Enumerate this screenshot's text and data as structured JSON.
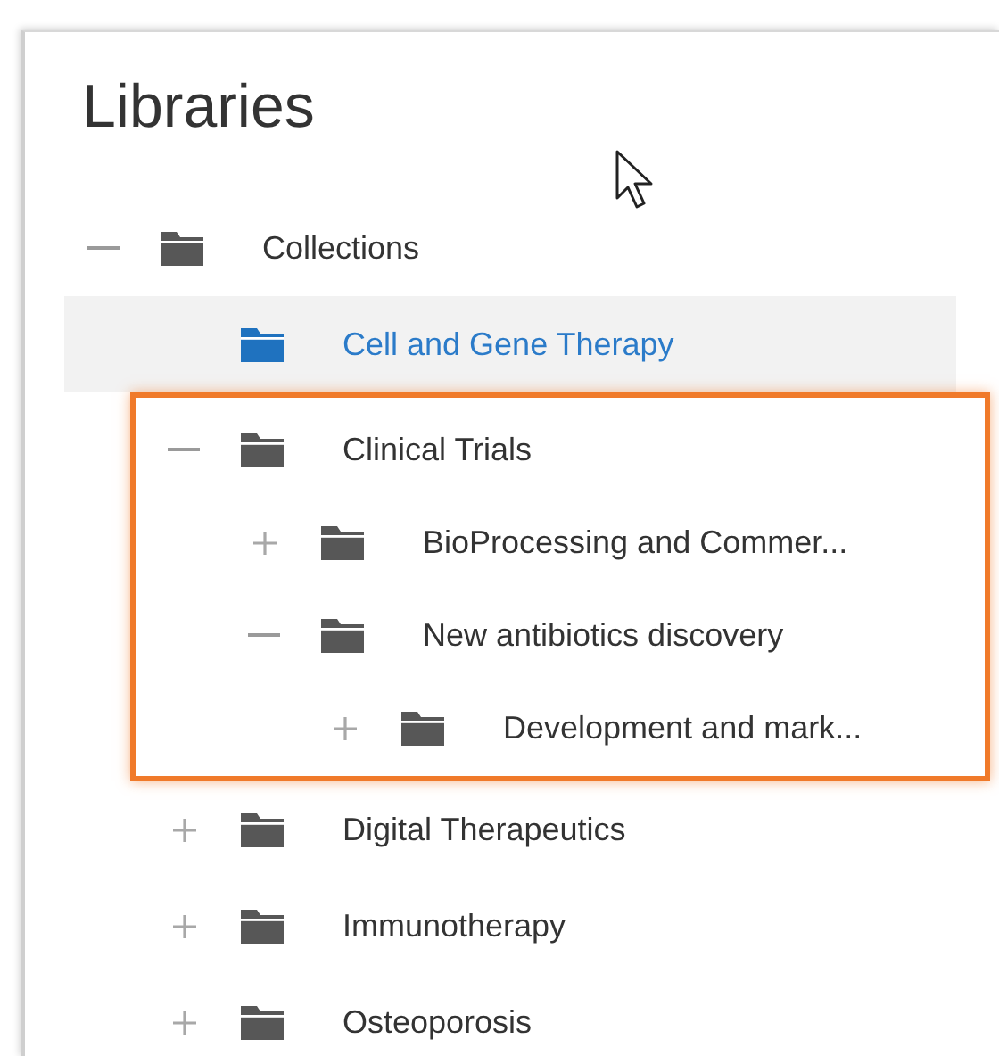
{
  "title": "Libraries",
  "tree": [
    {
      "label": "Collections",
      "kind": "node",
      "expanded": true,
      "selected": false,
      "highlighted": false,
      "children": [
        {
          "label": "Cell and Gene Therapy",
          "kind": "leaf",
          "selected": true,
          "highlighted": false
        },
        {
          "label": "Clinical Trials",
          "kind": "node",
          "expanded": true,
          "selected": false,
          "highlighted": true,
          "children": [
            {
              "label": "BioProcessing and Commer...",
              "kind": "node",
              "expanded": false,
              "selected": false,
              "highlighted": false
            },
            {
              "label": "New antibiotics discovery",
              "kind": "node",
              "expanded": true,
              "selected": false,
              "highlighted": false,
              "children": [
                {
                  "label": "Development and mark...",
                  "kind": "node",
                  "expanded": false,
                  "selected": false,
                  "highlighted": false
                }
              ]
            }
          ]
        },
        {
          "label": "Digital Therapeutics",
          "kind": "node",
          "expanded": false,
          "selected": false,
          "highlighted": false
        },
        {
          "label": "Immunotherapy",
          "kind": "node",
          "expanded": false,
          "selected": false,
          "highlighted": false
        },
        {
          "label": "Osteoporosis",
          "kind": "node",
          "expanded": false,
          "selected": false,
          "highlighted": false
        }
      ]
    }
  ]
}
